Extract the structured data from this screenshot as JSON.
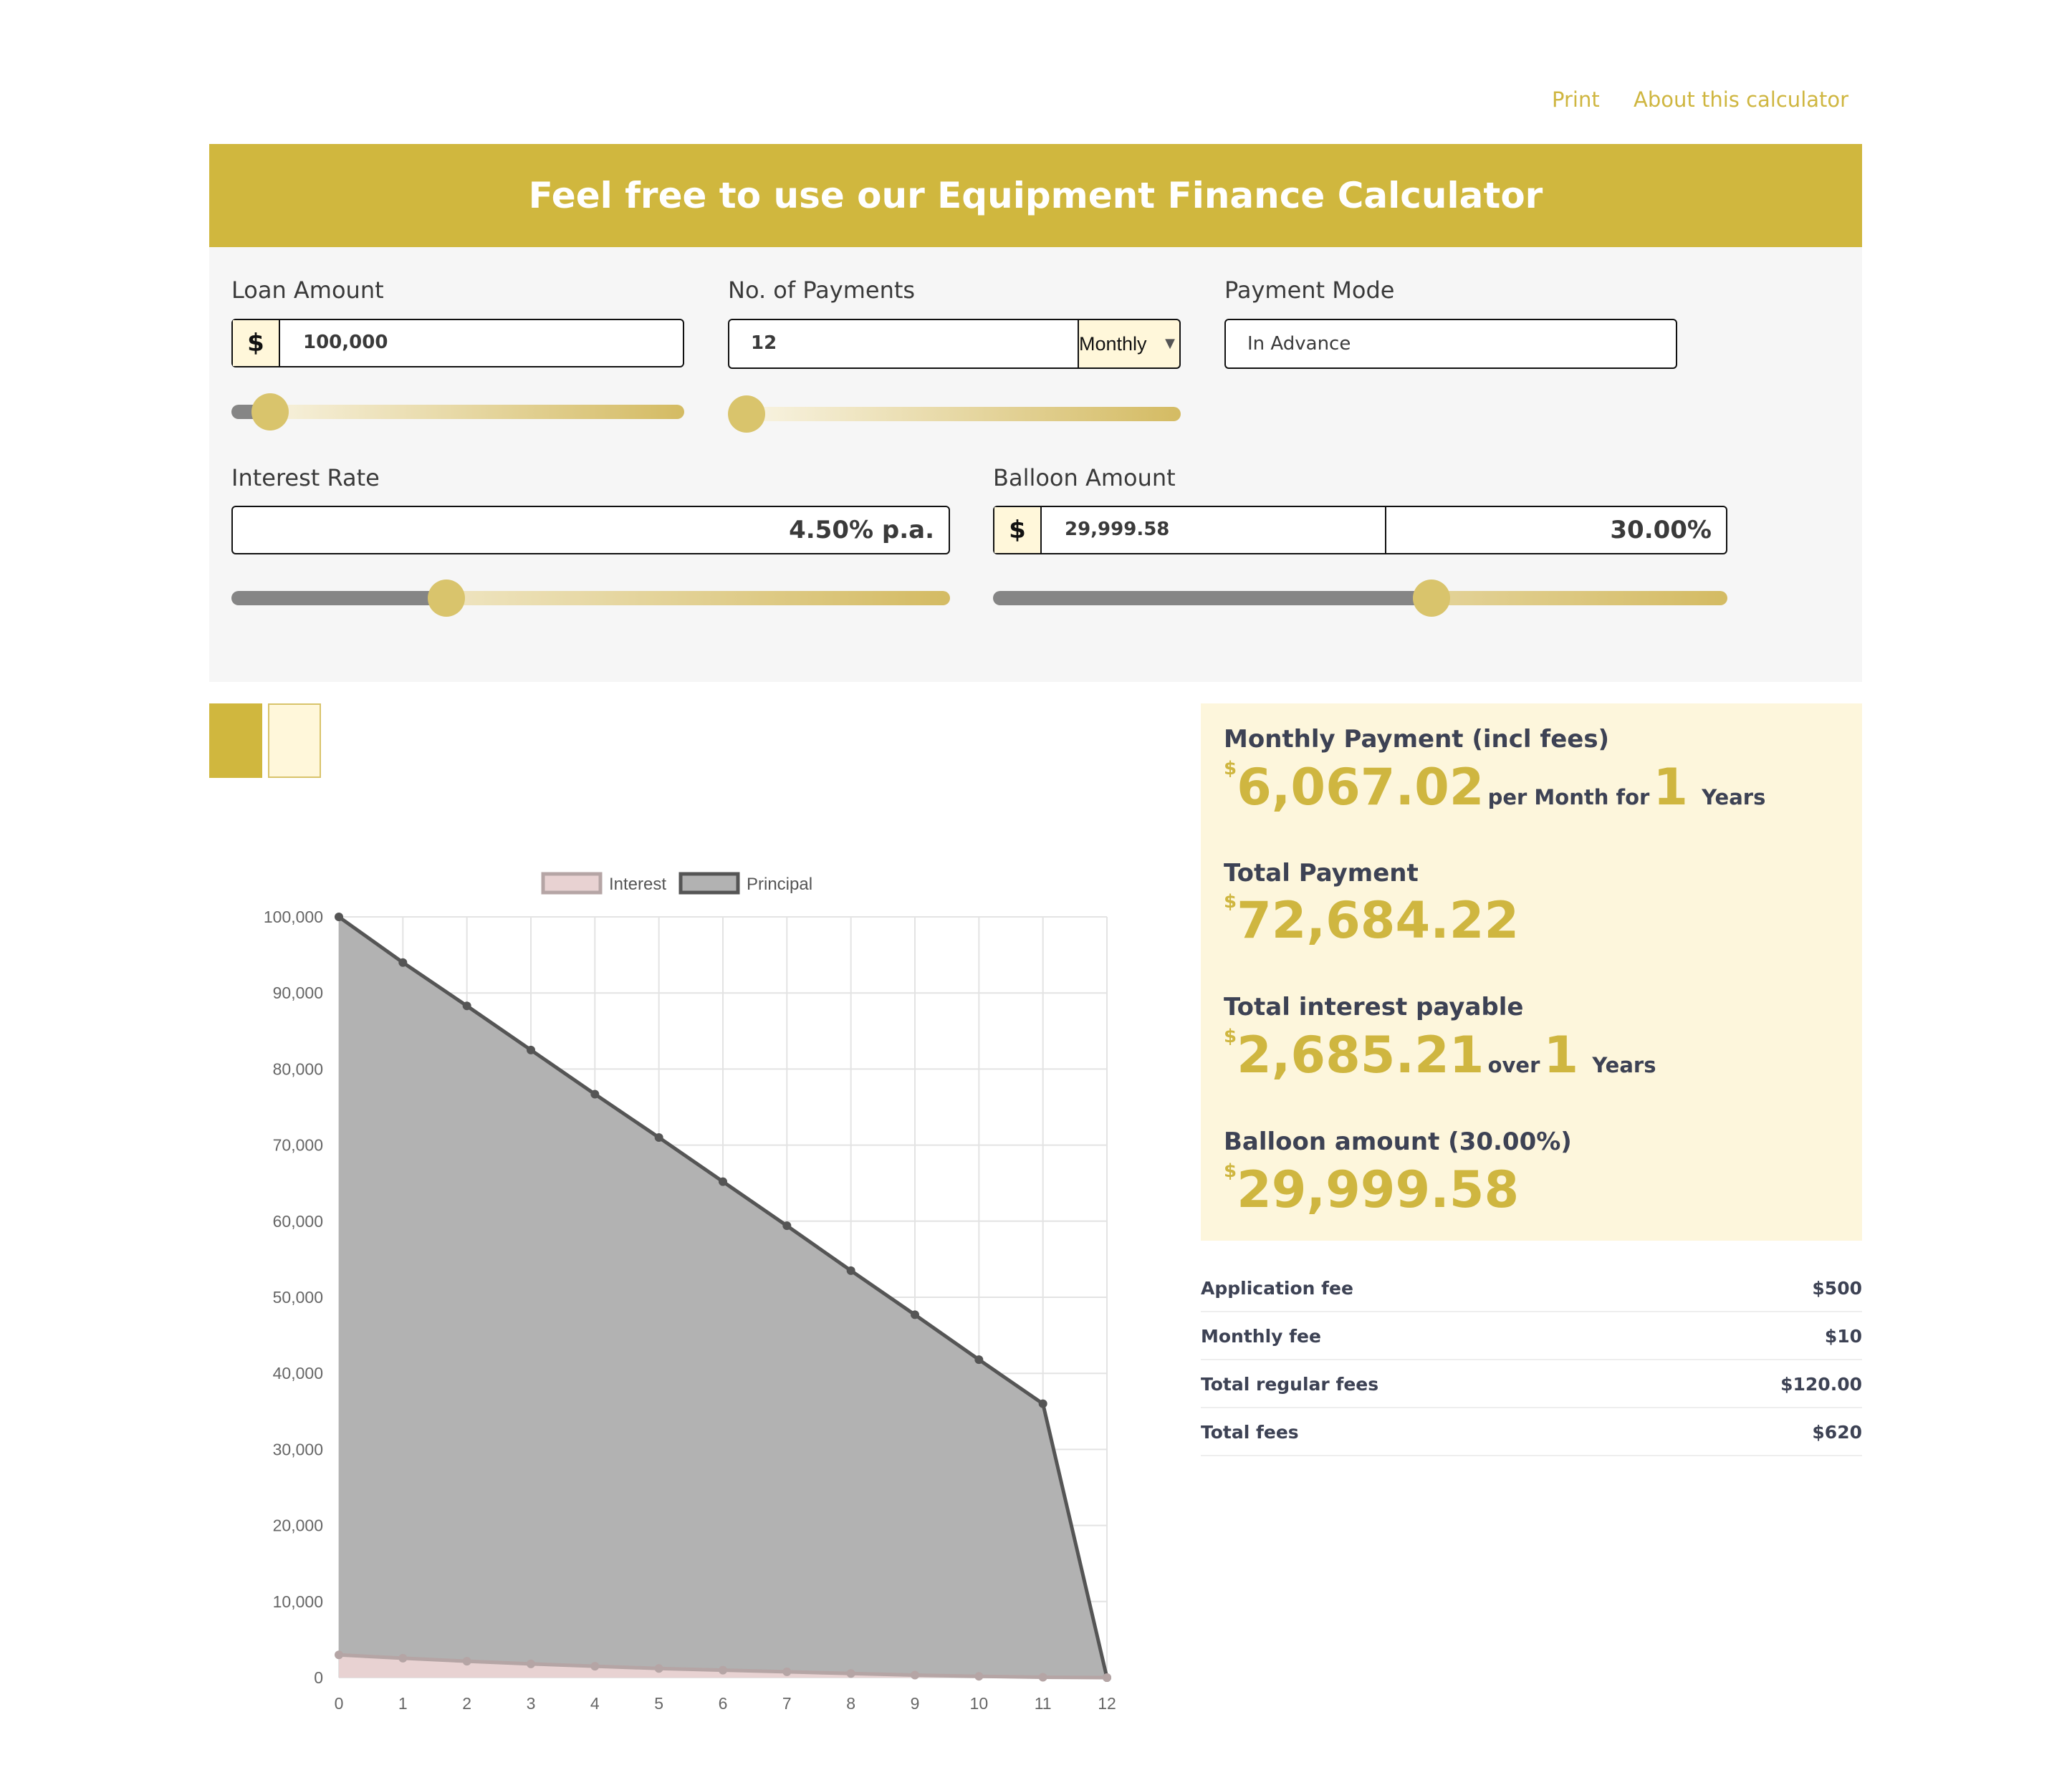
{
  "toplinks": {
    "print": "Print",
    "about": "About this calculator"
  },
  "banner": {
    "title": "Feel free to use our Equipment Finance Calculator"
  },
  "form": {
    "loan_amount": {
      "label": "Loan Amount",
      "currency": "$",
      "value": "100,000",
      "slider_fraction": 0.05
    },
    "num_payments": {
      "label": "No. of Payments",
      "value": "12",
      "frequency": "Monthly",
      "slider_fraction": 0.0
    },
    "payment_mode": {
      "label": "Payment Mode",
      "value": "In Advance"
    },
    "interest_rate": {
      "label": "Interest Rate",
      "value": "4.50% p.a.",
      "slider_fraction": 0.3
    },
    "balloon": {
      "label": "Balloon Amount",
      "currency": "$",
      "value": "29,999.58",
      "percent": "30.00%",
      "slider_fraction": 0.6
    }
  },
  "swatches": [
    "#d0b73e",
    "#fff7da"
  ],
  "results": {
    "monthly": {
      "label": "Monthly Payment (incl fees)",
      "sup": "$",
      "amount": "6,067.02",
      "per": "per Month for",
      "years": "1",
      "years_label": "Years"
    },
    "total_payment": {
      "label": "Total Payment",
      "sup": "$",
      "amount": "72,684.22"
    },
    "total_interest": {
      "label": "Total interest payable",
      "sup": "$",
      "amount": "2,685.21",
      "over": "over",
      "years": "1",
      "years_label": "Years"
    },
    "balloon": {
      "label": "Balloon amount (30.00%)",
      "sup": "$",
      "amount": "29,999.58"
    }
  },
  "fees": [
    {
      "label": "Application fee",
      "value": "$500"
    },
    {
      "label": "Monthly fee",
      "value": "$10"
    },
    {
      "label": "Total regular fees",
      "value": "$120.00"
    },
    {
      "label": "Total fees",
      "value": "$620"
    }
  ],
  "chart_data": {
    "type": "area",
    "x": [
      0,
      1,
      2,
      3,
      4,
      5,
      6,
      7,
      8,
      9,
      10,
      11,
      12
    ],
    "series": [
      {
        "name": "Interest",
        "color": "#e8d2d2",
        "line": "#b5a5a5",
        "values": [
          2990,
          2550,
          2150,
          1800,
          1500,
          1200,
          980,
          760,
          540,
          330,
          170,
          50,
          0
        ]
      },
      {
        "name": "Principal",
        "color": "#b2b2b2",
        "line": "#555555",
        "values": [
          100000,
          94000,
          88300,
          82500,
          76700,
          71000,
          65200,
          59400,
          53500,
          47700,
          41800,
          36000,
          0
        ]
      }
    ],
    "ylim": [
      0,
      100000
    ],
    "yticks": [
      "100,000",
      "90,000",
      "80,000",
      "70,000",
      "60,000",
      "50,000",
      "40,000",
      "30,000",
      "20,000",
      "10,000",
      "0"
    ],
    "grid": true,
    "legend": "top"
  }
}
